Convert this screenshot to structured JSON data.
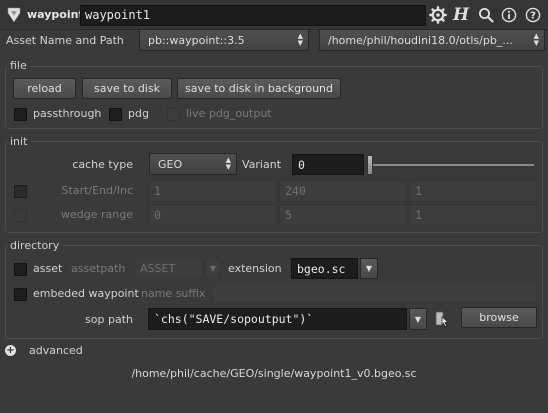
{
  "header": {
    "node_type": "waypoint",
    "node_name": "waypoint1",
    "icons": [
      "gear-icon",
      "houdini-help-icon",
      "search-icon",
      "info-icon",
      "help-icon"
    ]
  },
  "asset": {
    "label": "Asset Name and Path",
    "name_value": "pb::waypoint::3.5",
    "path_value": "/home/phil/houdini18.0/otls/pb_..."
  },
  "file_section": {
    "title": "file",
    "reload": "reload",
    "save_to_disk": "save to disk",
    "save_bg": "save to disk in background",
    "passthrough": "passthrough",
    "pdg": "pdg",
    "live_pdg": "live pdg_output"
  },
  "init_section": {
    "title": "init",
    "cache_type_label": "cache type",
    "cache_type_value": "GEO",
    "variant_label": "Variant",
    "variant_value": "0",
    "start_end_label": "Start/End/Inc",
    "start_end_values": [
      "1",
      "240",
      "1"
    ],
    "wedge_label": "wedge range",
    "wedge_values": [
      "0",
      "5",
      "1"
    ]
  },
  "directory_section": {
    "title": "directory",
    "asset_label": "asset",
    "assetpath_label": "assetpath",
    "assetpath_value": "ASSET",
    "extension_label": "extension",
    "extension_value": "bgeo.sc",
    "embeded_label": "embeded waypoint",
    "name_suffix_label": "name suffix",
    "name_suffix_value": "",
    "sop_path_label": "sop path",
    "sop_path_value": "`chs(\"SAVE/sopoutput\")`",
    "browse": "browse"
  },
  "advanced": {
    "label": "advanced"
  },
  "output_path": "/home/phil/cache/GEO/single/waypoint1_v0.bgeo.sc"
}
